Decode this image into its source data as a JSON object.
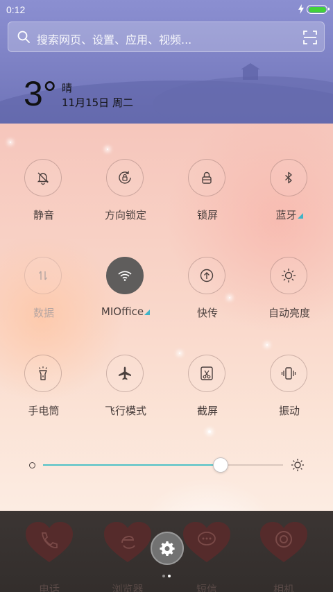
{
  "status_bar": {
    "time": "0:12",
    "battery_level": 1.0,
    "battery_color": "#42d13a",
    "charging_icon": "flash-icon"
  },
  "search": {
    "placeholder": "搜索网页、设置、应用、视频...",
    "icon": "search-icon",
    "scan_icon": "scan-icon"
  },
  "weather": {
    "temperature": "3°",
    "condition": "晴",
    "date": "11月15日 周二"
  },
  "toggles": [
    {
      "label": "静音",
      "icon": "bell-off-icon",
      "state": "off"
    },
    {
      "label": "方向锁定",
      "icon": "rotation-lock-icon",
      "state": "off"
    },
    {
      "label": "锁屏",
      "icon": "lock-icon",
      "state": "off"
    },
    {
      "label": "蓝牙",
      "icon": "bluetooth-icon",
      "state": "off",
      "has_more": true
    },
    {
      "label": "数据",
      "icon": "mobile-data-icon",
      "state": "disabled"
    },
    {
      "label": "MIOffice",
      "icon": "wifi-icon",
      "state": "on",
      "has_more": true
    },
    {
      "label": "快传",
      "icon": "upload-icon",
      "state": "off"
    },
    {
      "label": "自动亮度",
      "icon": "sun-icon",
      "state": "off"
    },
    {
      "label": "手电筒",
      "icon": "flashlight-icon",
      "state": "off"
    },
    {
      "label": "飞行模式",
      "icon": "airplane-icon",
      "state": "off"
    },
    {
      "label": "截屏",
      "icon": "screenshot-icon",
      "state": "off"
    },
    {
      "label": "振动",
      "icon": "vibrate-icon",
      "state": "off"
    }
  ],
  "brightness": {
    "level": 0.74,
    "accent": "#4ec1c6"
  },
  "dock": {
    "apps": [
      {
        "label": "电话",
        "icon": "phone-icon"
      },
      {
        "label": "浏览器",
        "icon": "browser-icon"
      },
      {
        "label": "短信",
        "icon": "messages-icon"
      },
      {
        "label": "相机",
        "icon": "camera-icon"
      }
    ],
    "settings_icon": "gear-icon",
    "pages": 2,
    "current_page": 2
  }
}
